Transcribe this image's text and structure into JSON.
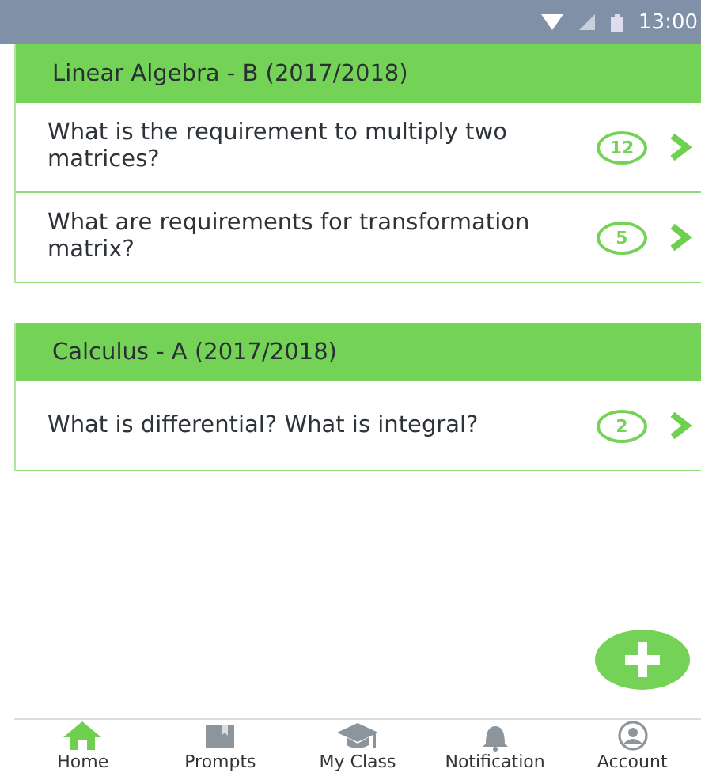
{
  "status_bar": {
    "time": "13:00"
  },
  "courses": [
    {
      "title": "Linear Algebra - B (2017/2018)",
      "questions": [
        {
          "text": "What is the requirement to multiply two matrices?",
          "count": "12"
        },
        {
          "text": "What are requirements for transformation matrix?",
          "count": "5"
        }
      ]
    },
    {
      "title": "Calculus - A (2017/2018)",
      "questions": [
        {
          "text": "What is differential? What is integral?",
          "count": "2"
        }
      ]
    }
  ],
  "nav": [
    {
      "label": "Home",
      "kind": "home",
      "selected": true
    },
    {
      "label": "Prompts",
      "kind": "prompts",
      "selected": false
    },
    {
      "label": "My Class",
      "kind": "class",
      "selected": false
    },
    {
      "label": "Notification",
      "kind": "bell",
      "selected": false
    },
    {
      "label": "Account",
      "kind": "account",
      "selected": false
    }
  ]
}
